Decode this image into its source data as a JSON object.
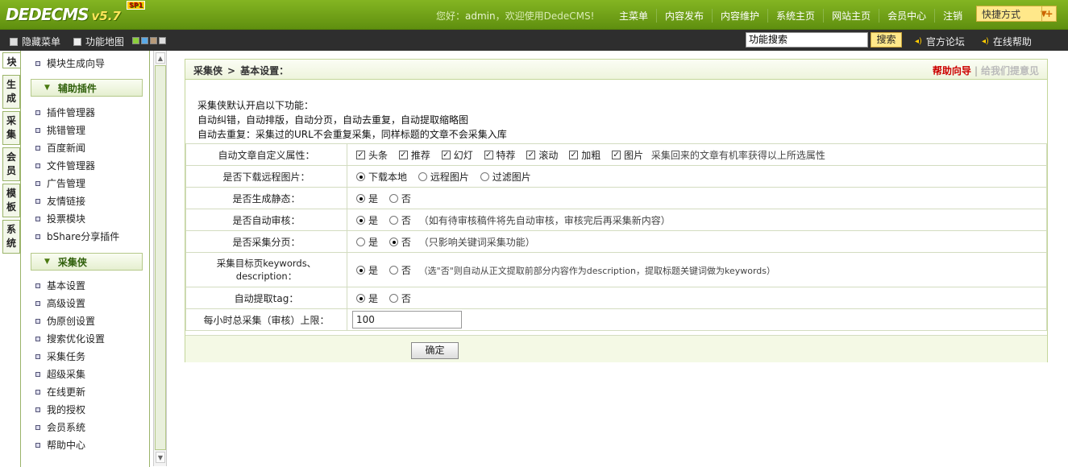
{
  "app": {
    "logo": "DEDECMS",
    "version": "v5.7",
    "sp": "SP1"
  },
  "header": {
    "welcome_prefix": "您好：",
    "user": "admin",
    "welcome_suffix": "，欢迎使用DedeCMS!",
    "nav": [
      "主菜单",
      "内容发布",
      "内容维护",
      "系统主页",
      "网站主页",
      "会员中心",
      "注销"
    ],
    "quick": "快捷方式"
  },
  "toolbar": {
    "hide_menu": "隐藏菜单",
    "site_map": "功能地图",
    "search_value": "功能搜索",
    "search_button": "搜索",
    "forum": "官方论坛",
    "help": "在线帮助"
  },
  "strip_tabs": [
    "块",
    "生成",
    "采集",
    "会员",
    "模板",
    "系统"
  ],
  "menu": {
    "top_item": "模块生成向导",
    "group1": "辅助插件",
    "group1_items": [
      "插件管理器",
      "挑错管理",
      "百度新闻",
      "文件管理器",
      "广告管理",
      "友情链接",
      "投票模块",
      "bShare分享插件"
    ],
    "group2": "采集侠",
    "group2_items": [
      "基本设置",
      "高级设置",
      "伪原创设置",
      "搜索优化设置",
      "采集任务",
      "超级采集",
      "在线更新",
      "我的授权",
      "会员系统",
      "帮助中心"
    ]
  },
  "panel": {
    "crumb1": "采集侠",
    "crumb2": "基本设置：",
    "help_guide": "帮助向导",
    "feedback": "给我们提意见",
    "intro": [
      "采集侠默认开启以下功能：",
      "自动纠错，自动排版，自动分页，自动去重复，自动提取缩略图",
      "自动去重复：采集过的URL不会重复采集，同样标题的文章不会采集入库"
    ]
  },
  "form": {
    "attr_label": "自动文章自定义属性：",
    "attr_options": [
      "头条",
      "推荐",
      "幻灯",
      "特荐",
      "滚动",
      "加粗",
      "图片"
    ],
    "attr_note": "采集回来的文章有机率获得以上所选属性",
    "remote_label": "是否下载远程图片：",
    "remote_options": [
      "下载本地",
      "远程图片",
      "过滤图片"
    ],
    "static_label": "是否生成静态：",
    "audit_label": "是否自动审核：",
    "audit_note": "（如有待审核稿件将先自动审核，审核完后再采集新内容）",
    "paging_label": "是否采集分页：",
    "paging_note": "（只影响关键词采集功能）",
    "kw_label": "采集目标页keywords、description：",
    "kw_note": "（选\"否\"则自动从正文提取前部分内容作为description，提取标题关键词做为keywords）",
    "tag_label": "自动提取tag：",
    "limit_label": "每小时总采集（审核）上限：",
    "limit_value": "100",
    "yes": "是",
    "no": "否",
    "submit": "确定"
  }
}
